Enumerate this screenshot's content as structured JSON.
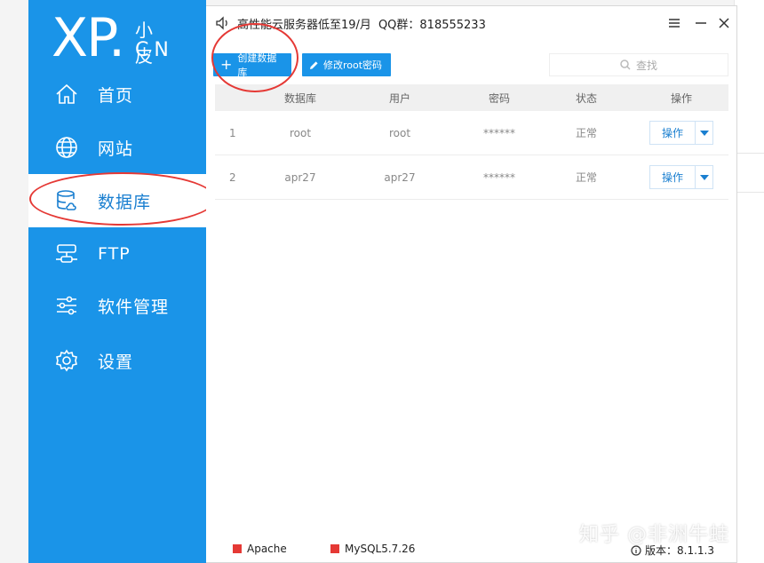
{
  "logo": {
    "brand": "XP.",
    "sub1": "小皮",
    "sub2": "CN"
  },
  "sidebar": {
    "items": [
      {
        "label": "首页",
        "icon": "home-icon"
      },
      {
        "label": "网站",
        "icon": "globe-icon"
      },
      {
        "label": "数据库",
        "icon": "database-icon",
        "active": true
      },
      {
        "label": "FTP",
        "icon": "ftp-icon"
      },
      {
        "label": "软件管理",
        "icon": "sliders-icon"
      },
      {
        "label": "设置",
        "icon": "gear-icon"
      }
    ]
  },
  "titlebar": {
    "notice": "高性能云服务器低至19/月",
    "qq": "QQ群：818555233"
  },
  "toolbar": {
    "create_label": "创建数据库",
    "modify_label": "修改root密码",
    "search_placeholder": "查找"
  },
  "table": {
    "headers": [
      "",
      "数据库",
      "用户",
      "密码",
      "状态",
      "操作"
    ],
    "rows": [
      {
        "index": "1",
        "db": "root",
        "user": "root",
        "password": "******",
        "status": "正常",
        "action": "操作"
      },
      {
        "index": "2",
        "db": "apr27",
        "user": "apr27",
        "password": "******",
        "status": "正常",
        "action": "操作"
      }
    ]
  },
  "statusbar": {
    "apache": "Apache",
    "mysql": "MySQL5.7.26",
    "version": "版本：8.1.1.3"
  },
  "watermark": "知乎 @非洲牛蛙",
  "colors": {
    "sidebar": "#1a94e8",
    "accent": "#1a94e8",
    "status_red": "#e53935",
    "annotation_red": "#e53935"
  }
}
